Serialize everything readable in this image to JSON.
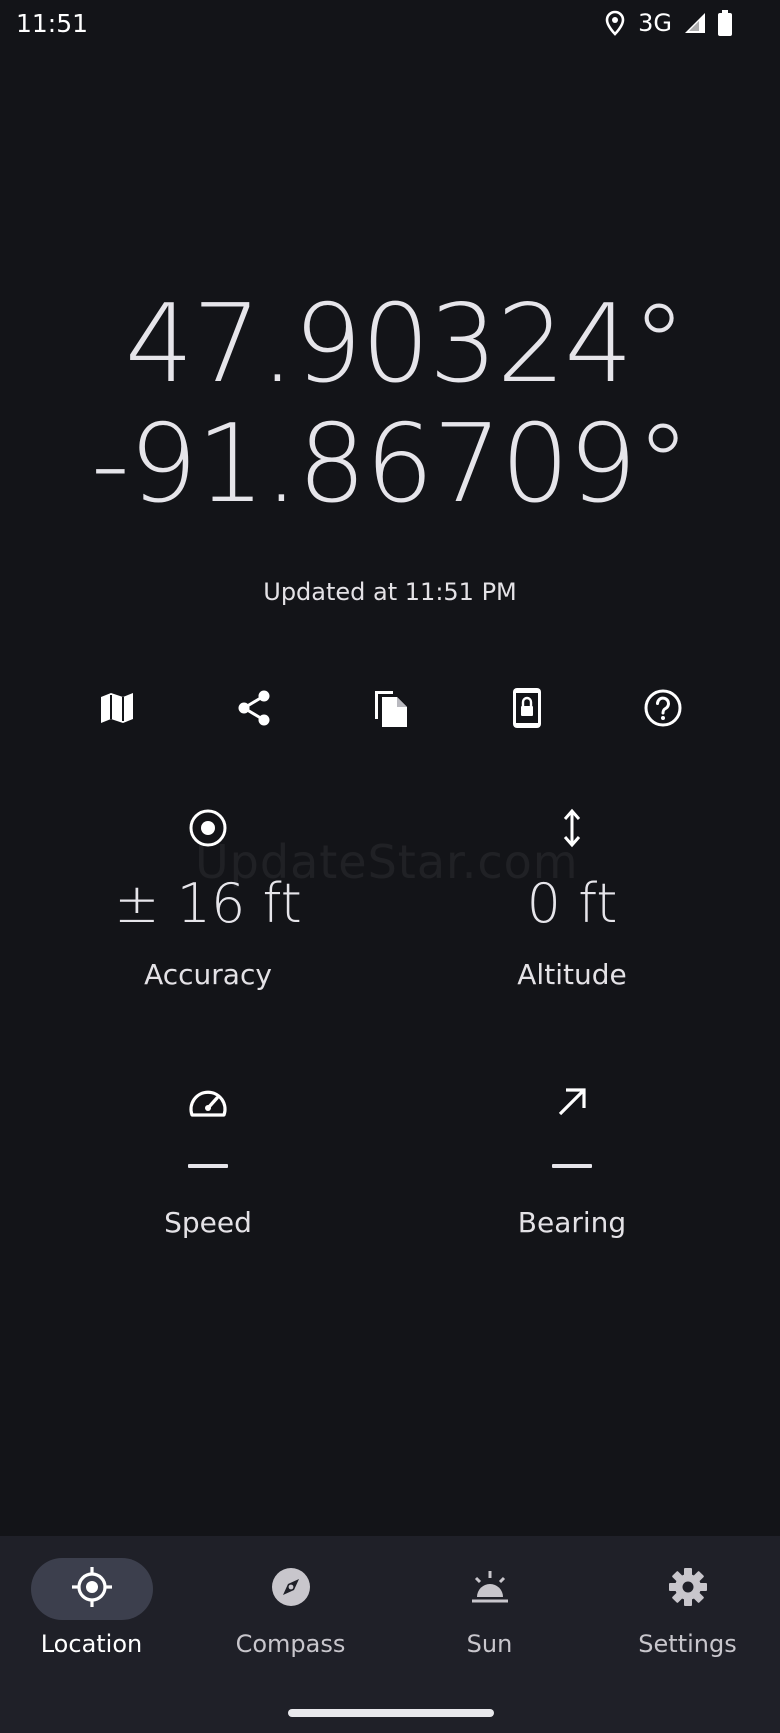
{
  "status_bar": {
    "time": "11:51",
    "network": "3G",
    "icons": [
      "location-pin-icon",
      "signal-icon",
      "battery-icon"
    ]
  },
  "location": {
    "latitude": "47.90324°",
    "longitude": "-91.86709°",
    "updated": "Updated at 11:51 PM"
  },
  "actions": [
    {
      "icon": "map-icon"
    },
    {
      "icon": "share-icon"
    },
    {
      "icon": "copy-icon"
    },
    {
      "icon": "lock-screen-icon"
    },
    {
      "icon": "help-icon"
    }
  ],
  "stats": {
    "accuracy": {
      "value": "± 16 ft",
      "label": "Accuracy",
      "icon": "target-icon"
    },
    "altitude": {
      "value": "0 ft",
      "label": "Altitude",
      "icon": "vertical-arrows-icon"
    },
    "speed": {
      "value": "",
      "label": "Speed",
      "icon": "speedometer-icon"
    },
    "bearing": {
      "value": "",
      "label": "Bearing",
      "icon": "north-east-arrow-icon"
    }
  },
  "watermark": "UpdateStar.com",
  "nav": {
    "items": [
      {
        "label": "Location",
        "icon": "crosshair-icon",
        "active": true
      },
      {
        "label": "Compass",
        "icon": "compass-icon",
        "active": false
      },
      {
        "label": "Sun",
        "icon": "sunrise-icon",
        "active": false
      },
      {
        "label": "Settings",
        "icon": "gear-icon",
        "active": false
      }
    ]
  },
  "colors": {
    "background": "#131418",
    "nav_background": "#1f2028",
    "active_pill": "#3c3f4d",
    "text": "#e4e2e6"
  }
}
